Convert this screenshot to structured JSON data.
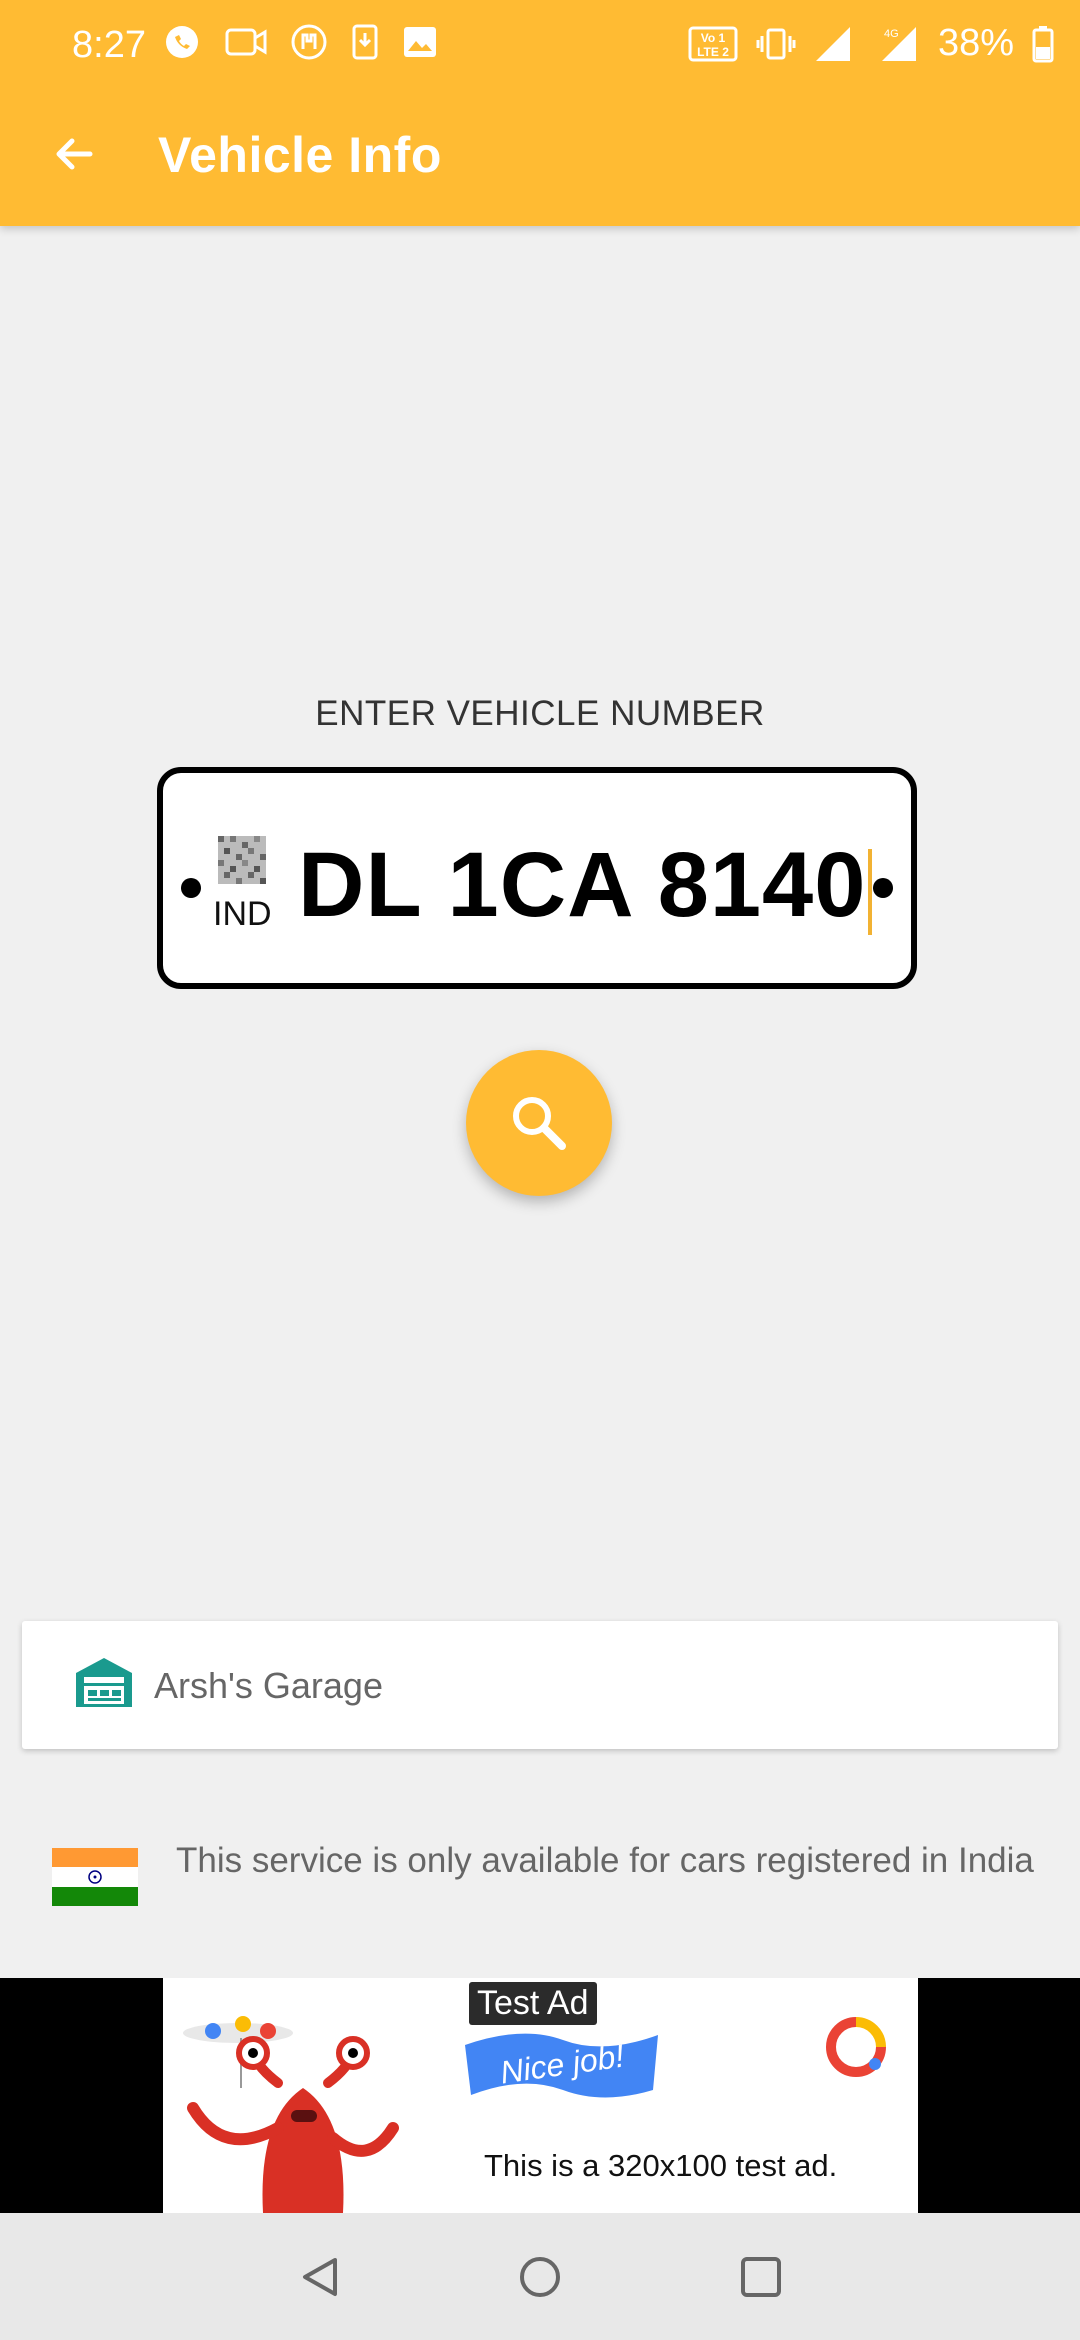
{
  "status_bar": {
    "time": "8:27",
    "battery_percent": "38%",
    "network_label": "4G",
    "icons_left": [
      "whatsapp-icon",
      "video-call-icon",
      "app-icon",
      "download-icon",
      "gallery-icon"
    ],
    "icons_right": [
      "volte-icon",
      "vibrate-icon",
      "signal-icon",
      "signal-4g-icon",
      "battery-icon"
    ]
  },
  "app_bar": {
    "title": "Vehicle Info",
    "back_icon": "arrow-back-icon",
    "color": "#ffbb33"
  },
  "form": {
    "label": "ENTER VEHICLE NUMBER",
    "plate_country": "IND",
    "plate_value": "DL 1CA 8140",
    "search_icon": "search-icon"
  },
  "garage": {
    "label": "Arsh's Garage",
    "icon": "garage-icon"
  },
  "notice": {
    "text": "This service is only available for cars registered in India",
    "icon": "india-flag-icon"
  },
  "ad": {
    "tag": "Test Ad",
    "badge": "Nice job!",
    "text": "This is a 320x100 test ad."
  },
  "nav": {
    "back": "nav-back-icon",
    "home": "nav-home-icon",
    "recents": "nav-recents-icon"
  }
}
